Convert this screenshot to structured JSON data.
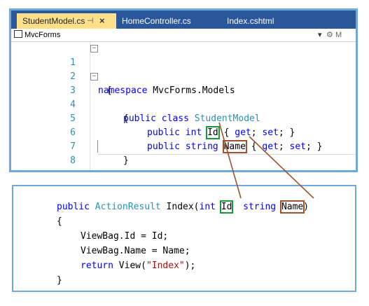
{
  "tabs": [
    {
      "label": "StudentModel.cs",
      "pin": "⊣",
      "close": "×"
    },
    {
      "label": "HomeController.cs"
    },
    {
      "label": "Index.cshtml"
    }
  ],
  "navbar": {
    "project": "MvcForms",
    "right_fragment": "M"
  },
  "editor": {
    "line_numbers": [
      "1",
      "2",
      "3",
      "4",
      "5",
      "6",
      "7",
      "8"
    ],
    "l1": {
      "kw": "namespace",
      "rest": " MvcForms.Models"
    },
    "l2": "{",
    "l3": {
      "kw1": "public",
      "kw2": "class",
      "type": "StudentModel"
    },
    "l4": "{",
    "l5": {
      "kw1": "public",
      "kw2": "int",
      "prop": "Id",
      "b1": "{",
      "get": "get",
      "set": "set",
      "b2": "}"
    },
    "l6": {
      "kw1": "public",
      "kw2": "string",
      "prop": "Name",
      "b1": "{",
      "get": "get",
      "set": "set",
      "b2": "}"
    },
    "l7": "}",
    "l8": "}"
  },
  "controller": {
    "sig": {
      "kw": "public",
      "type": "ActionResult",
      "method": " Index(",
      "kw_int": "int",
      "param1": "Id",
      "kw_string": "string",
      "param2": "Name",
      "close": ")"
    },
    "open_brace": "{",
    "stmt1": "ViewBag.Id = Id;",
    "stmt2": "ViewBag.Name = Name;",
    "stmt3": {
      "kw": "return",
      "call": " View(",
      "str": "\"Index\"",
      "end": ");"
    },
    "close_brace": "}"
  },
  "colors": {
    "frame": "#6fa8dc",
    "green_box": "#1a9641",
    "brown_box": "#a0522d",
    "tab_active": "#ffe08a",
    "tabbar": "#2b579a"
  }
}
